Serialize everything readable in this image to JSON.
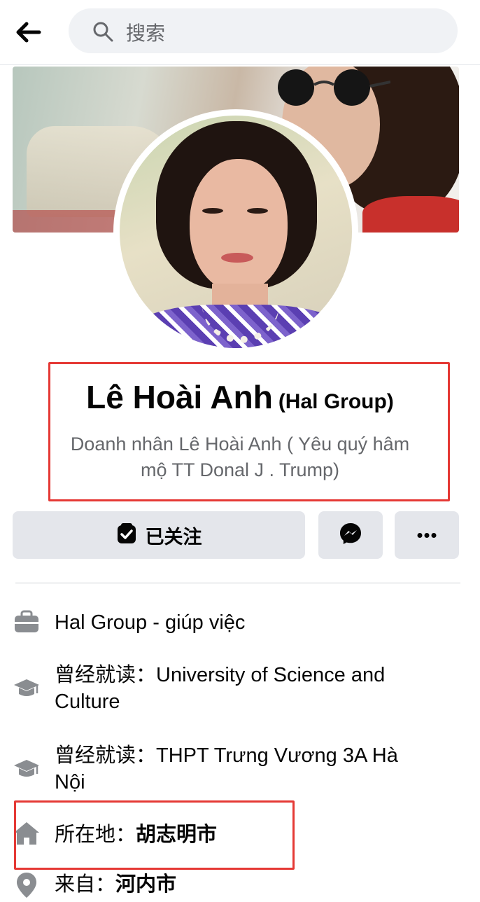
{
  "search": {
    "placeholder": "搜索"
  },
  "profile": {
    "name": "Lê Hoài Anh",
    "alias": "(Hal Group)",
    "bio_line1": "Doanh nhân Lê Hoài Anh ( Yêu quý hâm",
    "bio_line2": "mộ TT Donal J . Trump)"
  },
  "actions": {
    "follow_label": "已关注"
  },
  "info": {
    "work": "Hal Group - giúp việc",
    "edu1_prefix": "曾经就读：",
    "edu1_value_line1": "University of Science and",
    "edu1_value_line2": "Culture",
    "edu2_prefix": "曾经就读：",
    "edu2_value_line1": "THPT Trưng Vương 3A Hà",
    "edu2_value_line2": "Nội",
    "location_prefix": "所在地：",
    "location_value": "胡志明市",
    "from_prefix": "来自：",
    "from_value": "河内市"
  },
  "colors": {
    "highlight": "#e53935",
    "button_bg": "#e4e6eb",
    "secondary_text": "#65676b",
    "icon_gray": "#8a8d91"
  },
  "icons": [
    "back-arrow-icon",
    "search-icon",
    "followed-icon",
    "messenger-icon",
    "more-icon",
    "briefcase-icon",
    "graduation-cap-icon",
    "home-icon",
    "location-pin-icon"
  ]
}
